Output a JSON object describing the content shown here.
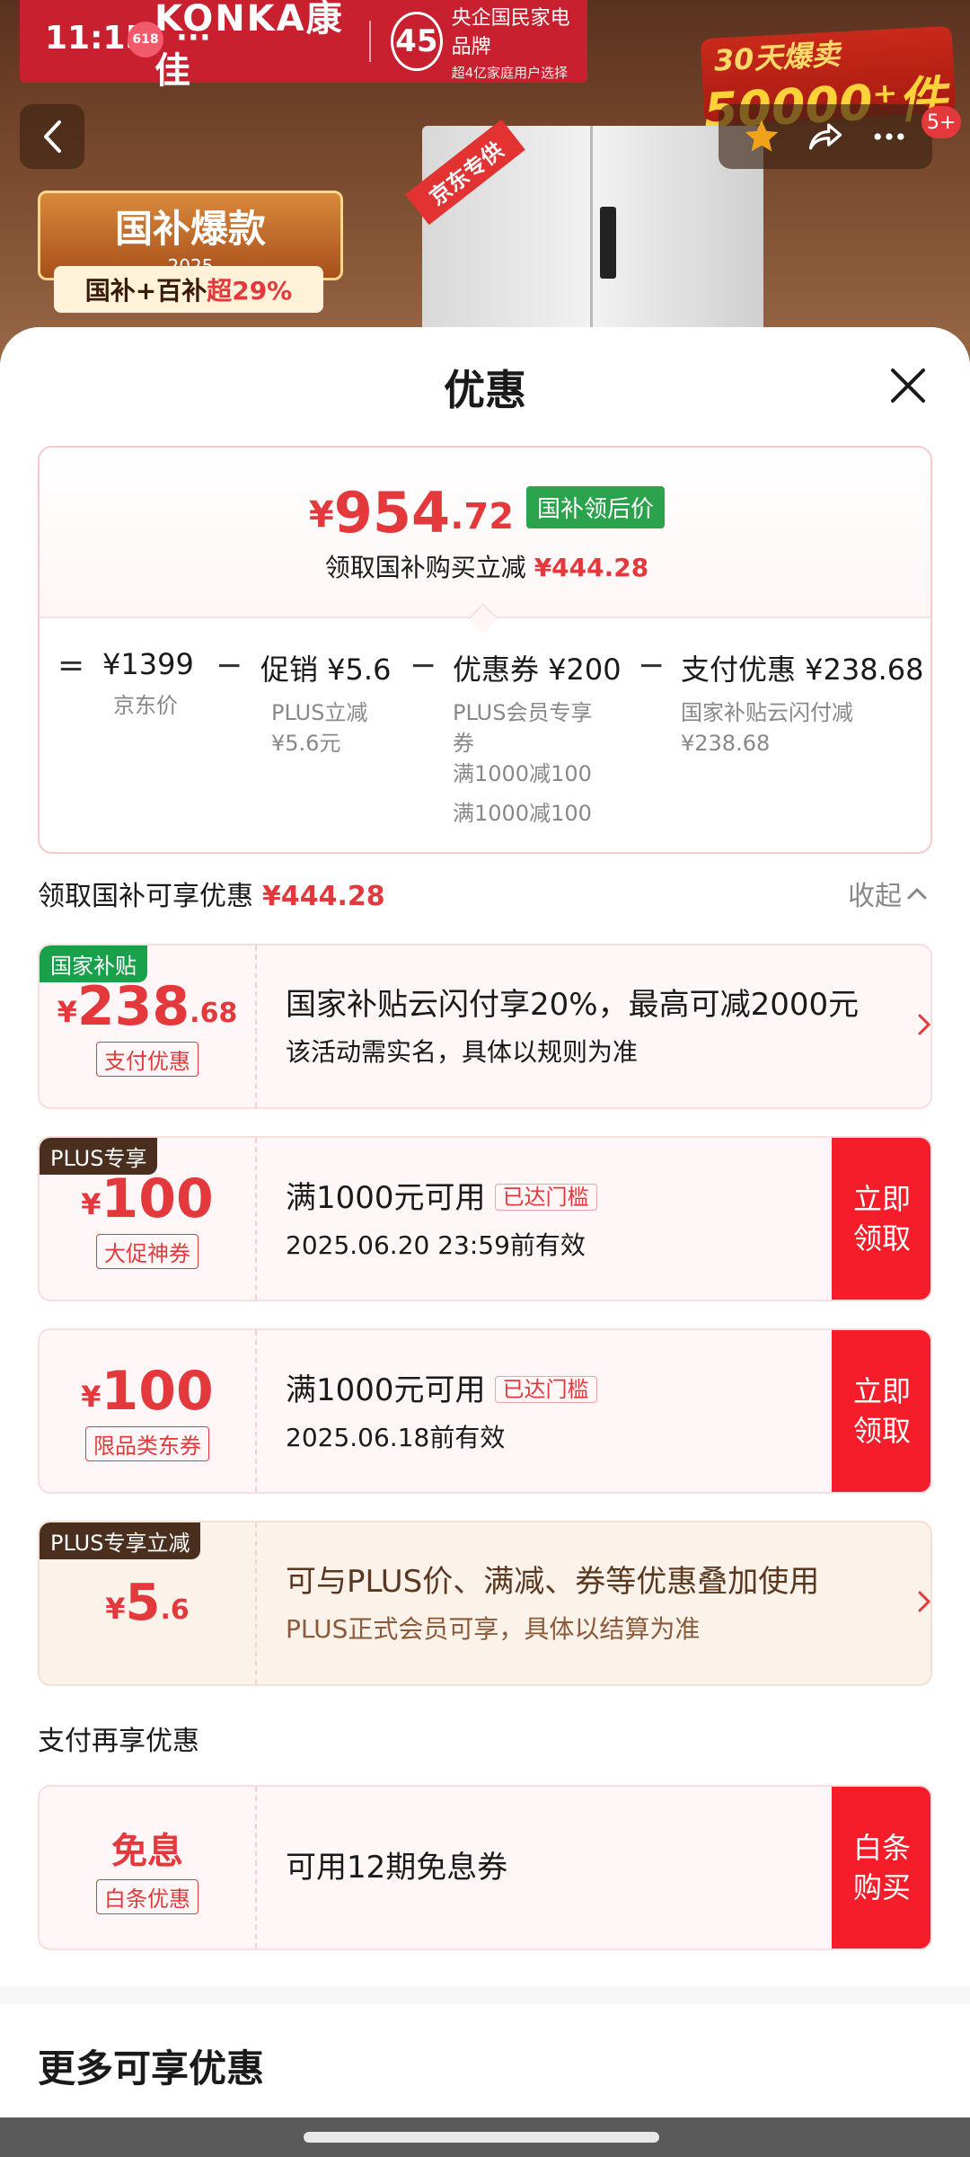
{
  "status_bar": {
    "time": "11:15",
    "badge": "618",
    "dots": "···"
  },
  "hero": {
    "brand": "KONKA康佳",
    "anniversary": "45",
    "slogan_line1": "央企国民家电品牌",
    "slogan_line2": "超4亿家庭用户选择",
    "sales_line1": "30天爆卖",
    "sales_line2": "50000⁺件",
    "promo_title": "国补爆款",
    "promo_year": "2025",
    "promo_sub_prefix": "国补+百补",
    "promo_sub_highlight": "超29%",
    "fridge_ribbon": "京东专供",
    "nav_count": "5+"
  },
  "sheet": {
    "title": "优惠",
    "price": {
      "yen": "¥",
      "integer": "954",
      "decimal": ".72",
      "tag": "国补领后价",
      "sub_text": "领取国补购买立减",
      "sub_amount": "¥444.28"
    },
    "breakdown": {
      "eq": "=",
      "items": [
        {
          "main": "¥1399",
          "sub1": "京东价",
          "sub2": "",
          "sub3": "",
          "sub4": ""
        },
        {
          "main": "促销 ¥5.6",
          "sub1": "PLUS立减",
          "sub2": "¥5.6元",
          "sub3": "",
          "sub4": ""
        },
        {
          "main": "优惠券 ¥200",
          "sub1": "PLUS会员专享",
          "sub2": "券",
          "sub3": "满1000减100",
          "sub4": "满1000减100"
        },
        {
          "main": "支付优惠 ¥238.68",
          "sub1": "国家补贴云闪付减",
          "sub2": "¥238.68",
          "sub3": "",
          "sub4": ""
        }
      ],
      "minus": "−"
    },
    "section": {
      "label": "领取国补可享优惠",
      "amount": "¥444.28",
      "collapse": "收起"
    },
    "cards": [
      {
        "corner": "国家补贴",
        "yen": "¥",
        "amount": "238",
        "decimal": ".68",
        "pill": "支付优惠",
        "line1": "国家补贴云闪付享20%，最高可减2000元",
        "line2": "该活动需实名，具体以规则为准"
      },
      {
        "corner": "PLUS专享",
        "yen": "¥",
        "amount": "100",
        "pill": "大促神券",
        "line1": "满1000元可用",
        "hit": "已达门槛",
        "line2": "2025.06.20 23:59前有效",
        "cta": "立即领取"
      },
      {
        "yen": "¥",
        "amount": "100",
        "pill": "限品类东券",
        "line1": "满1000元可用",
        "hit": "已达门槛",
        "line2": "2025.06.18前有效",
        "cta": "立即领取"
      },
      {
        "corner": "PLUS专享立减",
        "yen": "¥",
        "amount": "5",
        "decimal": ".6",
        "line1": "可与PLUS价、满减、券等优惠叠加使用",
        "line2": "PLUS正式会员可享，具体以结算为准"
      }
    ],
    "pay_section": "支付再享优惠",
    "pay_card": {
      "title": "免息",
      "pill": "白条优惠",
      "line1": "可用12期免息券",
      "cta": "白条购买"
    },
    "more_title": "更多可享优惠"
  },
  "colors": {
    "accent": "#e4393c",
    "cta": "#f61d2a",
    "green_tag": "#2ba24c",
    "plus_brown": "#4a2f1e"
  }
}
